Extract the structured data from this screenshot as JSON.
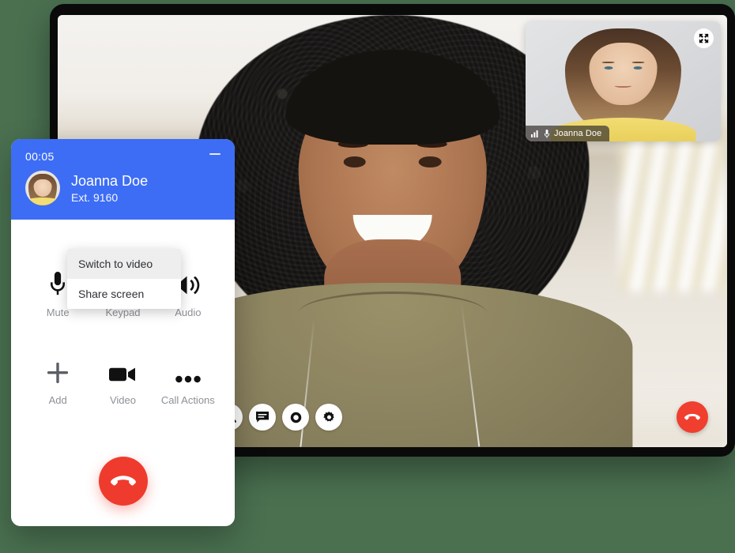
{
  "theme": {
    "page_background": "#4a7050",
    "brand_blue": "#3d6df5",
    "hangup_red": "#ef3b2d",
    "toolbar_hangup_red": "#f03e2f",
    "menu_highlight": "#eeeeee"
  },
  "device": {
    "name": "video-call-device"
  },
  "video_call": {
    "pip": {
      "participant_name": "Joanna Doe",
      "expand_icon": "expand-icon",
      "signal_icon": "signal-bars-icon",
      "mic_icon": "microphone-icon"
    },
    "toolbar": {
      "buttons": [
        {
          "name": "mute-button",
          "icon": "microphone-icon"
        },
        {
          "name": "video-button",
          "icon": "video-camera-icon"
        },
        {
          "name": "share-button",
          "icon": "share-upload-icon"
        },
        {
          "name": "add-participant-button",
          "icon": "person-add-icon"
        },
        {
          "name": "participants-button",
          "icon": "people-icon"
        },
        {
          "name": "chat-button",
          "icon": "chat-bubble-icon"
        },
        {
          "name": "record-button",
          "icon": "record-circle-icon"
        },
        {
          "name": "settings-button",
          "icon": "gear-icon"
        }
      ],
      "hangup": {
        "name": "hangup-button",
        "icon": "phone-hangup-icon"
      }
    }
  },
  "softphone": {
    "timer": "00:05",
    "minimize_icon": "minimize-icon",
    "caller": {
      "name": "Joanna Doe",
      "extension": "Ext. 9160",
      "avatar": "avatar"
    },
    "actions": [
      {
        "label": "Mute",
        "icon": "microphone-icon"
      },
      {
        "label": "Keypad",
        "icon": "keypad-dots-icon"
      },
      {
        "label": "Audio",
        "icon": "speaker-icon"
      },
      {
        "label": "Add",
        "icon": "plus-icon"
      },
      {
        "label": "Video",
        "icon": "video-camera-icon"
      },
      {
        "label": "Call Actions",
        "icon": "ellipsis-icon"
      }
    ],
    "hangup": {
      "name": "hangup-button",
      "icon": "phone-hangup-icon"
    }
  },
  "dropdown": {
    "items": [
      {
        "label": "Switch to video",
        "active": true
      },
      {
        "label": "Share screen",
        "active": false
      }
    ]
  }
}
